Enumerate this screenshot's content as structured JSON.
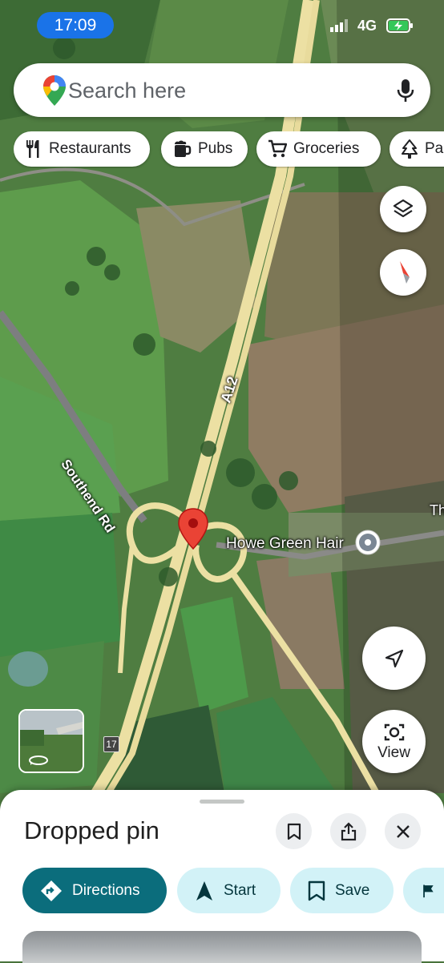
{
  "status_bar": {
    "time": "17:09",
    "network": "4G"
  },
  "search": {
    "placeholder": "Search here",
    "logo_icon": "maps-pin-icon",
    "mic_icon": "microphone-icon"
  },
  "chips": [
    {
      "label": "Restaurants",
      "icon": "fork-knife-icon"
    },
    {
      "label": "Pubs",
      "icon": "beer-mug-icon"
    },
    {
      "label": "Groceries",
      "icon": "cart-icon"
    },
    {
      "label": "Pa",
      "icon": "tree-icon"
    }
  ],
  "map": {
    "road_labels": [
      "A12",
      "Southend Rd",
      "Th"
    ],
    "place_label": "Howe Green Hair",
    "junction_shield": "17",
    "colors": {
      "pin_red": "#ea4335",
      "road_yellow": "#f0e2a2",
      "field_green": "#5a8f47"
    }
  },
  "controls": {
    "layers_icon": "layers-icon",
    "compass_icon": "compass-icon",
    "location_icon": "navigation-arrow-icon",
    "view_label": "View"
  },
  "sheet": {
    "title": "Dropped pin",
    "header_icons": [
      "bookmark-icon",
      "share-icon",
      "close-icon"
    ],
    "actions": [
      {
        "label": "Directions",
        "icon": "directions-icon"
      },
      {
        "label": "Start",
        "icon": "navigation-icon"
      },
      {
        "label": "Save",
        "icon": "bookmark-icon"
      },
      {
        "label": "",
        "icon": "flag-icon"
      }
    ],
    "colors": {
      "primary": "#0b6d7c",
      "secondary": "#d2f2f7"
    }
  }
}
